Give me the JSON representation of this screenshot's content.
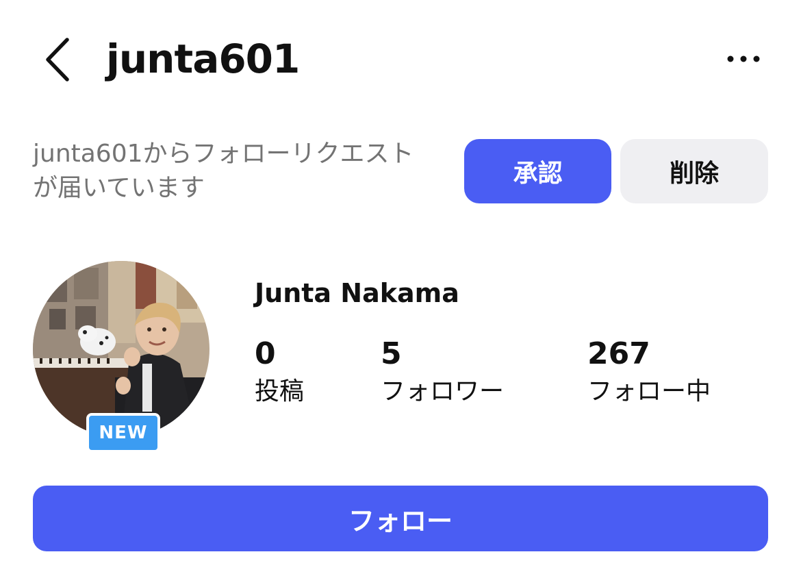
{
  "header": {
    "back_icon": "chevron-left-icon",
    "username": "junta601",
    "more_icon": "more-horizontal-icon"
  },
  "follow_request": {
    "message": "junta601からフォローリクエストが届いています",
    "approve_label": "承認",
    "delete_label": "削除"
  },
  "profile": {
    "display_name": "Junta Nakama",
    "new_badge": "NEW",
    "stats": [
      {
        "count": "0",
        "label": "投稿"
      },
      {
        "count": "5",
        "label": "フォロワー"
      },
      {
        "count": "267",
        "label": "フォロー中"
      }
    ]
  },
  "actions": {
    "follow_label": "フォロー"
  },
  "colors": {
    "accent": "#4a5df3",
    "secondary_button": "#efeff2",
    "badge": "#3b9cf2",
    "muted_text": "#737373"
  }
}
